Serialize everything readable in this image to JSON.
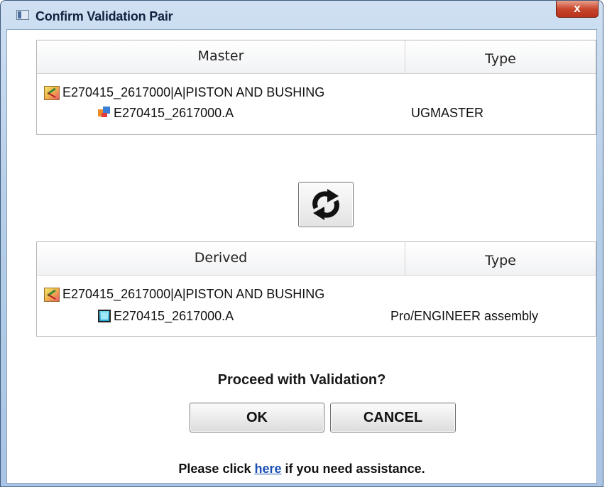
{
  "window": {
    "title": "Confirm Validation Pair",
    "close_label": "x"
  },
  "master_grid": {
    "columns": [
      "Master",
      "Type"
    ],
    "item": {
      "label": "E270415_2617000|A|PISTON AND BUSHING",
      "icon": "item-revision-icon"
    },
    "dataset": {
      "label": "E270415_2617000.A",
      "type": "UGMASTER",
      "icon": "ug-part-icon"
    }
  },
  "swap": {
    "icon": "swap-arrows-icon"
  },
  "derived_grid": {
    "columns": [
      "Derived",
      "Type"
    ],
    "item": {
      "label": "E270415_2617000|A|PISTON AND BUSHING",
      "icon": "item-revision-icon"
    },
    "dataset": {
      "label": "E270415_2617000.A",
      "type": "Pro/ENGINEER assembly",
      "icon": "proe-assembly-icon"
    }
  },
  "prompt": {
    "question": "Proceed with Validation?"
  },
  "buttons": {
    "ok": "OK",
    "cancel": "CANCEL"
  },
  "assistance": {
    "before": "Please click ",
    "link": "here",
    "after": " if you need assistance."
  },
  "colors": {
    "link": "#1b4fb3",
    "close": "#c9472e",
    "titlebar": "#b7cfe9"
  }
}
